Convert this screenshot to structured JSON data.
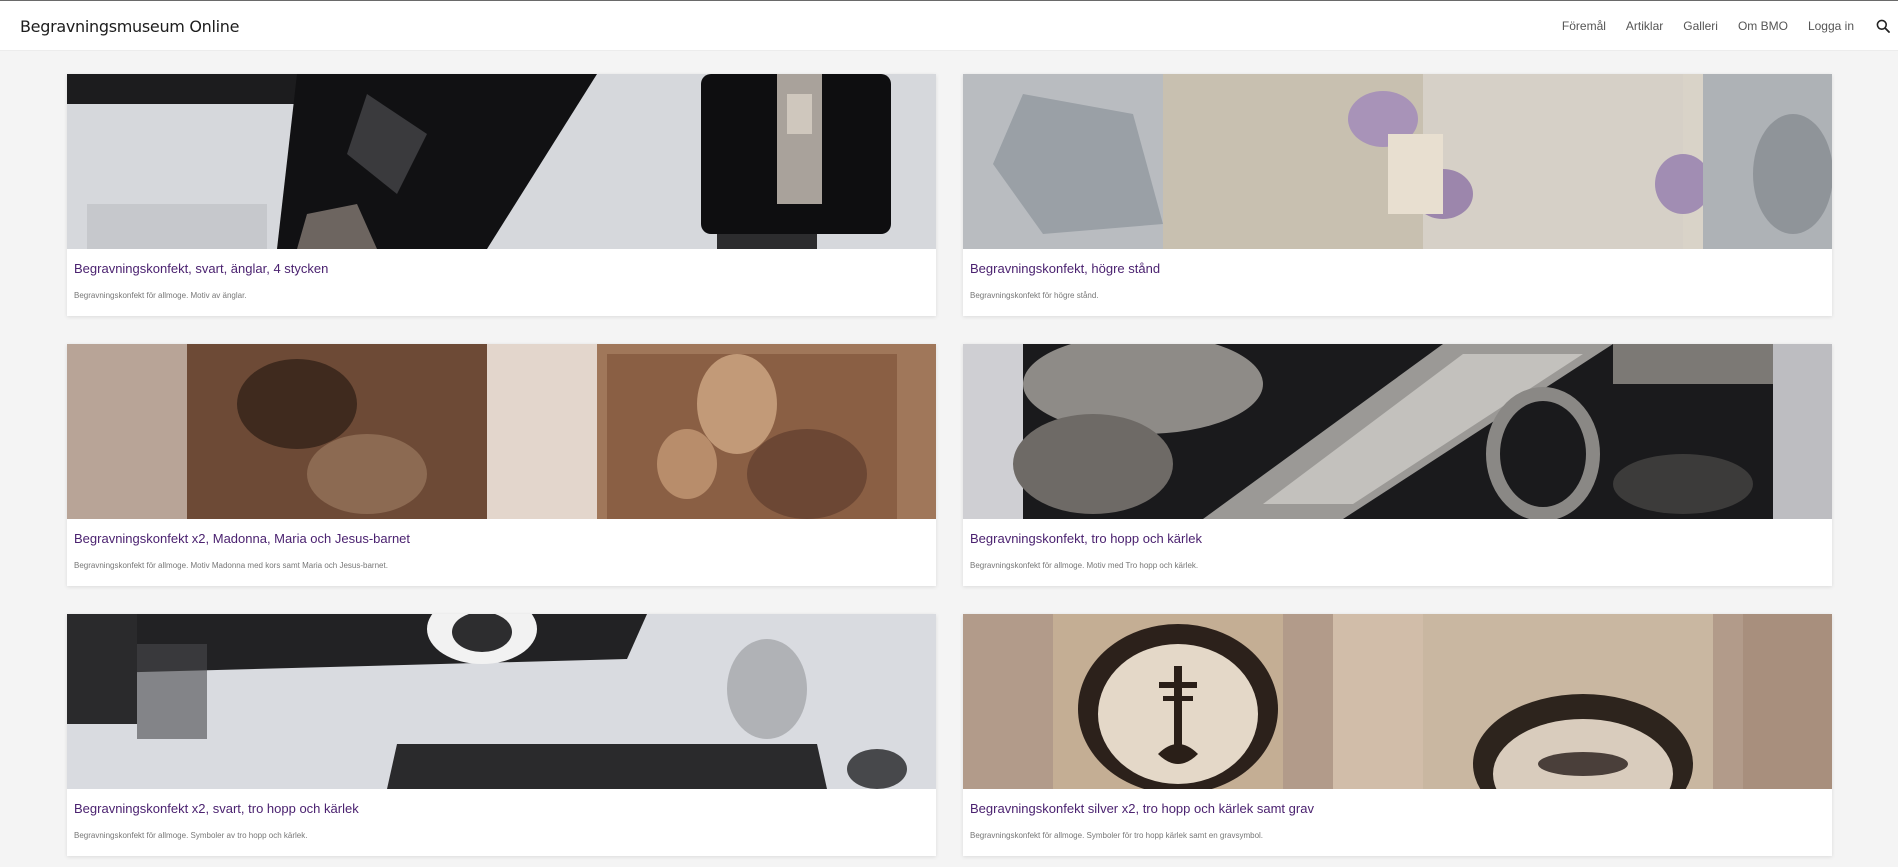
{
  "site": {
    "brand": "Begravningsmuseum Online"
  },
  "nav": {
    "items": [
      "Föremål",
      "Artiklar",
      "Galleri",
      "Om BMO",
      "Logga in"
    ]
  },
  "cards": [
    {
      "title": "Begravningskonfekt, svart, änglar, 4 stycken",
      "description": "Begravningskonfekt för allmoge. Motiv av änglar."
    },
    {
      "title": "Begravningskonfekt, högre stånd",
      "description": "Begravningskonfekt för högre stånd."
    },
    {
      "title": "Begravningskonfekt x2, Madonna, Maria och Jesus-barnet",
      "description": "Begravningskonfekt för allmoge. Motiv Madonna med kors samt Maria och Jesus-barnet."
    },
    {
      "title": "Begravningskonfekt, tro hopp och kärlek",
      "description": "Begravningskonfekt för allmoge. Motiv med Tro hopp och kärlek."
    },
    {
      "title": "Begravningskonfekt x2, svart, tro hopp och kärlek",
      "description": "Begravningskonfekt för allmoge. Symboler av tro hopp och kärlek."
    },
    {
      "title": "Begravningskonfekt silver x2, tro hopp och kärlek samt grav",
      "description": "Begravningskonfekt för allmoge. Symboler för tro hopp kärlek samt en gravsymbol."
    }
  ]
}
